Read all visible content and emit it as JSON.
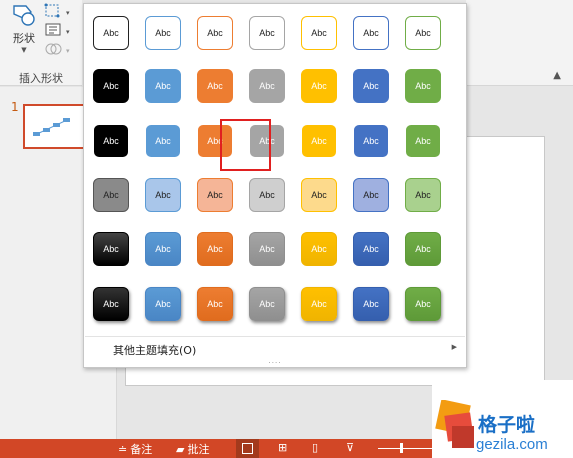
{
  "ribbon": {
    "shape_label": "形状",
    "group_label": "插入形状",
    "icons": [
      "shapes-icon",
      "edit-shape-icon",
      "text-box-icon",
      "merge-shapes-icon"
    ]
  },
  "thumbnails": {
    "slide_number": "1"
  },
  "gallery": {
    "tile_label": "Abc",
    "more_fills_label": "其他主题填充(O)",
    "selected": {
      "row": 3,
      "col": 2
    },
    "colors": [
      "#ffffff",
      "#5b9bd5",
      "#ed7d31",
      "#a5a5a5",
      "#ffc000",
      "#4472c4",
      "#70ad47"
    ],
    "rows": [
      {
        "style": "outline",
        "tiles": [
          "Abc",
          "Abc",
          "Abc",
          "Abc",
          "Abc",
          "Abc",
          "Abc"
        ]
      },
      {
        "style": "filled",
        "tiles": [
          "Abc",
          "Abc",
          "Abc",
          "Abc",
          "Abc",
          "Abc",
          "Abc"
        ]
      },
      {
        "style": "filled-light-outline",
        "tiles": [
          "Abc",
          "Abc",
          "Abc",
          "Abc",
          "Abc",
          "Abc",
          "Abc"
        ]
      },
      {
        "style": "light-tint",
        "tiles": [
          "Abc",
          "Abc",
          "Abc",
          "Abc",
          "Abc",
          "Abc",
          "Abc"
        ]
      },
      {
        "style": "gradient",
        "tiles": [
          "Abc",
          "Abc",
          "Abc",
          "Abc",
          "Abc",
          "Abc",
          "Abc"
        ]
      },
      {
        "style": "intense",
        "tiles": [
          "Abc",
          "Abc",
          "Abc",
          "Abc",
          "Abc",
          "Abc",
          "Abc"
        ]
      }
    ]
  },
  "statusbar": {
    "notes_label": "备注",
    "comments_label": "批注"
  },
  "watermark": {
    "title": "格子啦",
    "url": "gezila.com"
  }
}
